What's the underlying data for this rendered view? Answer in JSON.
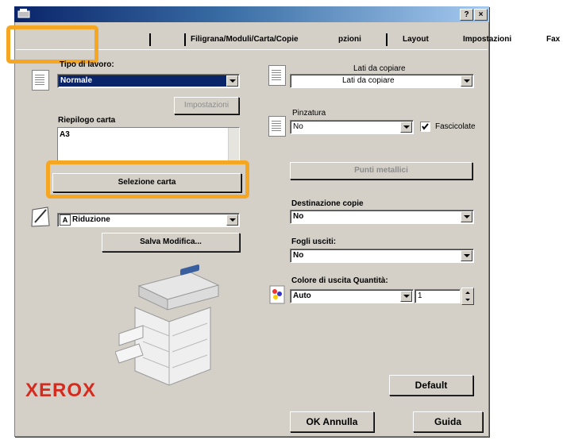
{
  "window": {
    "help_button": "?",
    "close_button": "×"
  },
  "tabs": [
    "",
    "",
    "Filigrana/Moduli/Carta/Copie",
    "pzioni",
    "Layout",
    "Impostazioni",
    "Fax"
  ],
  "left": {
    "job_type_label": "Tipo di lavoro:",
    "job_type_value": "Normale",
    "settings_button": "Impostazioni",
    "paper_summary_label": "Riepilogo carta",
    "paper_summary_value": "A3",
    "paper_select_button": "Selezione carta",
    "reduction_value": "Riduzione",
    "reduction_icon": "A",
    "save_changes_button": "Salva Modifica..."
  },
  "right": {
    "sides_label": "Lati da copiare",
    "sides_value": "Lati da copiare",
    "stapling_label": "Pinzatura",
    "stapling_value": "No",
    "collate_label": "Fascicolate",
    "collate_checked": true,
    "staple_points_button": "Punti metallici",
    "destination_label": "Destinazione copie",
    "destination_value": "No",
    "sheets_label": "Fogli usciti:",
    "sheets_value": "No",
    "color_qty_label": "Colore di uscita Quantità:",
    "color_value": "Auto",
    "quantity_value": "1"
  },
  "brand": "XEROX",
  "buttons": {
    "default": "Default",
    "ok_cancel": "OK Annulla",
    "help": "Guida"
  }
}
